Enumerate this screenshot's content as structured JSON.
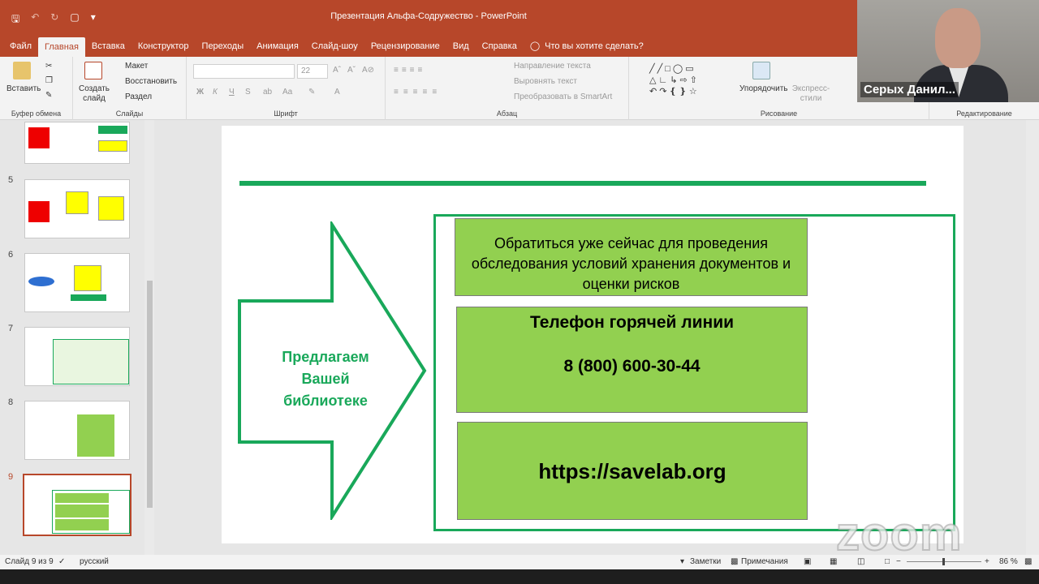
{
  "window": {
    "title": "Презентация Альфа-Содружество  -  PowerPoint"
  },
  "menu": {
    "tabs": [
      "Файл",
      "Главная",
      "Вставка",
      "Конструктор",
      "Переходы",
      "Анимация",
      "Слайд-шоу",
      "Рецензирование",
      "Вид",
      "Справка"
    ],
    "active_tab": "Главная",
    "tell_me": "Что вы хотите сделать?"
  },
  "ribbon": {
    "clipboard": {
      "paste": "Вставить",
      "label": "Буфер обмена"
    },
    "slides": {
      "new_slide": "Создать слайд",
      "layout": "Макет",
      "reset": "Восстановить",
      "section": "Раздел",
      "label": "Слайды"
    },
    "font": {
      "size": "22",
      "bold": "Ж",
      "italic": "К",
      "underline": "Ч",
      "strike": "S",
      "label": "Шрифт"
    },
    "paragraph": {
      "text_direction": "Направление текста",
      "align_text": "Выровнять текст",
      "smartart": "Преобразовать в SmartArt",
      "label": "Абзац"
    },
    "drawing": {
      "arrange": "Упорядочить",
      "quick_styles": "Экспресс-стили",
      "label": "Рисование"
    },
    "editing": {
      "label": "Редактирование"
    }
  },
  "video": {
    "participant_name": "Серых Данил..."
  },
  "thumbnails": [
    {
      "number": "",
      "selected": false
    },
    {
      "number": "5",
      "selected": false
    },
    {
      "number": "6",
      "selected": false
    },
    {
      "number": "7",
      "selected": false
    },
    {
      "number": "8",
      "selected": false
    },
    {
      "number": "9",
      "selected": true
    }
  ],
  "slide": {
    "arrow_text": "Предлагаем Вашей библиотеке",
    "box1": "Обратиться уже сейчас для проведения обследования условий хранения документов и оценки рисков",
    "hotline_title": "Телефон горячей линии",
    "hotline_phone": "8 (800) 600-30-44",
    "website": "https://savelab.org",
    "accent_color": "#19a85a",
    "box_color": "#92d050"
  },
  "status": {
    "slide_counter": "Слайд 9 из 9",
    "language": "русский",
    "notes": "Заметки",
    "comments": "Примечания",
    "zoom": "86 %"
  },
  "watermark": "zoom"
}
